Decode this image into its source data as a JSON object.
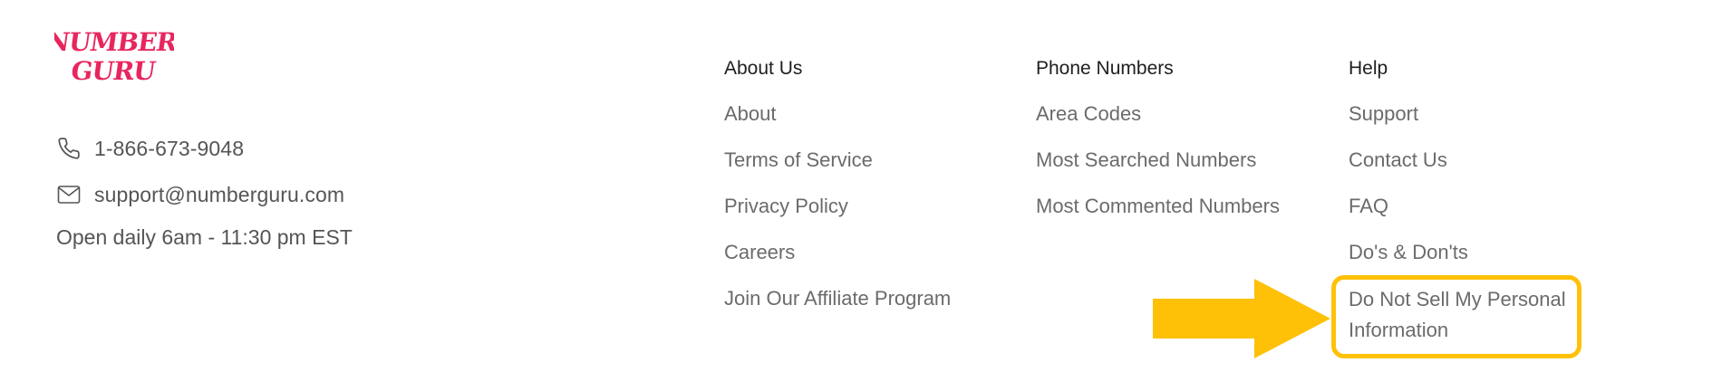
{
  "logo": {
    "line1": "NUMBER",
    "line2": "GURU",
    "color": "#e8265e"
  },
  "contact": {
    "phone": "1-866-673-9048",
    "phone_icon": "phone-icon",
    "email": "support@numberguru.com",
    "email_icon": "envelope-icon",
    "hours": "Open daily 6am - 11:30 pm EST"
  },
  "columns": {
    "about": {
      "heading": "About Us",
      "links": [
        "About",
        "Terms of Service",
        "Privacy Policy",
        "Careers",
        "Join Our Affiliate Program"
      ]
    },
    "phone_numbers": {
      "heading": "Phone Numbers",
      "links": [
        "Area Codes",
        "Most Searched Numbers",
        "Most Commented Numbers"
      ]
    },
    "help": {
      "heading": "Help",
      "links": [
        "Support",
        "Contact Us",
        "FAQ",
        "Do's & Don'ts",
        "Do Not Sell My Personal Information"
      ]
    }
  },
  "annotation": {
    "highlight_color": "#ffc107",
    "arrow_icon": "arrow-right-icon"
  },
  "colors": {
    "heading_text": "#1f1f1f",
    "link_text": "#6b6b6b",
    "contact_text": "#555555"
  }
}
